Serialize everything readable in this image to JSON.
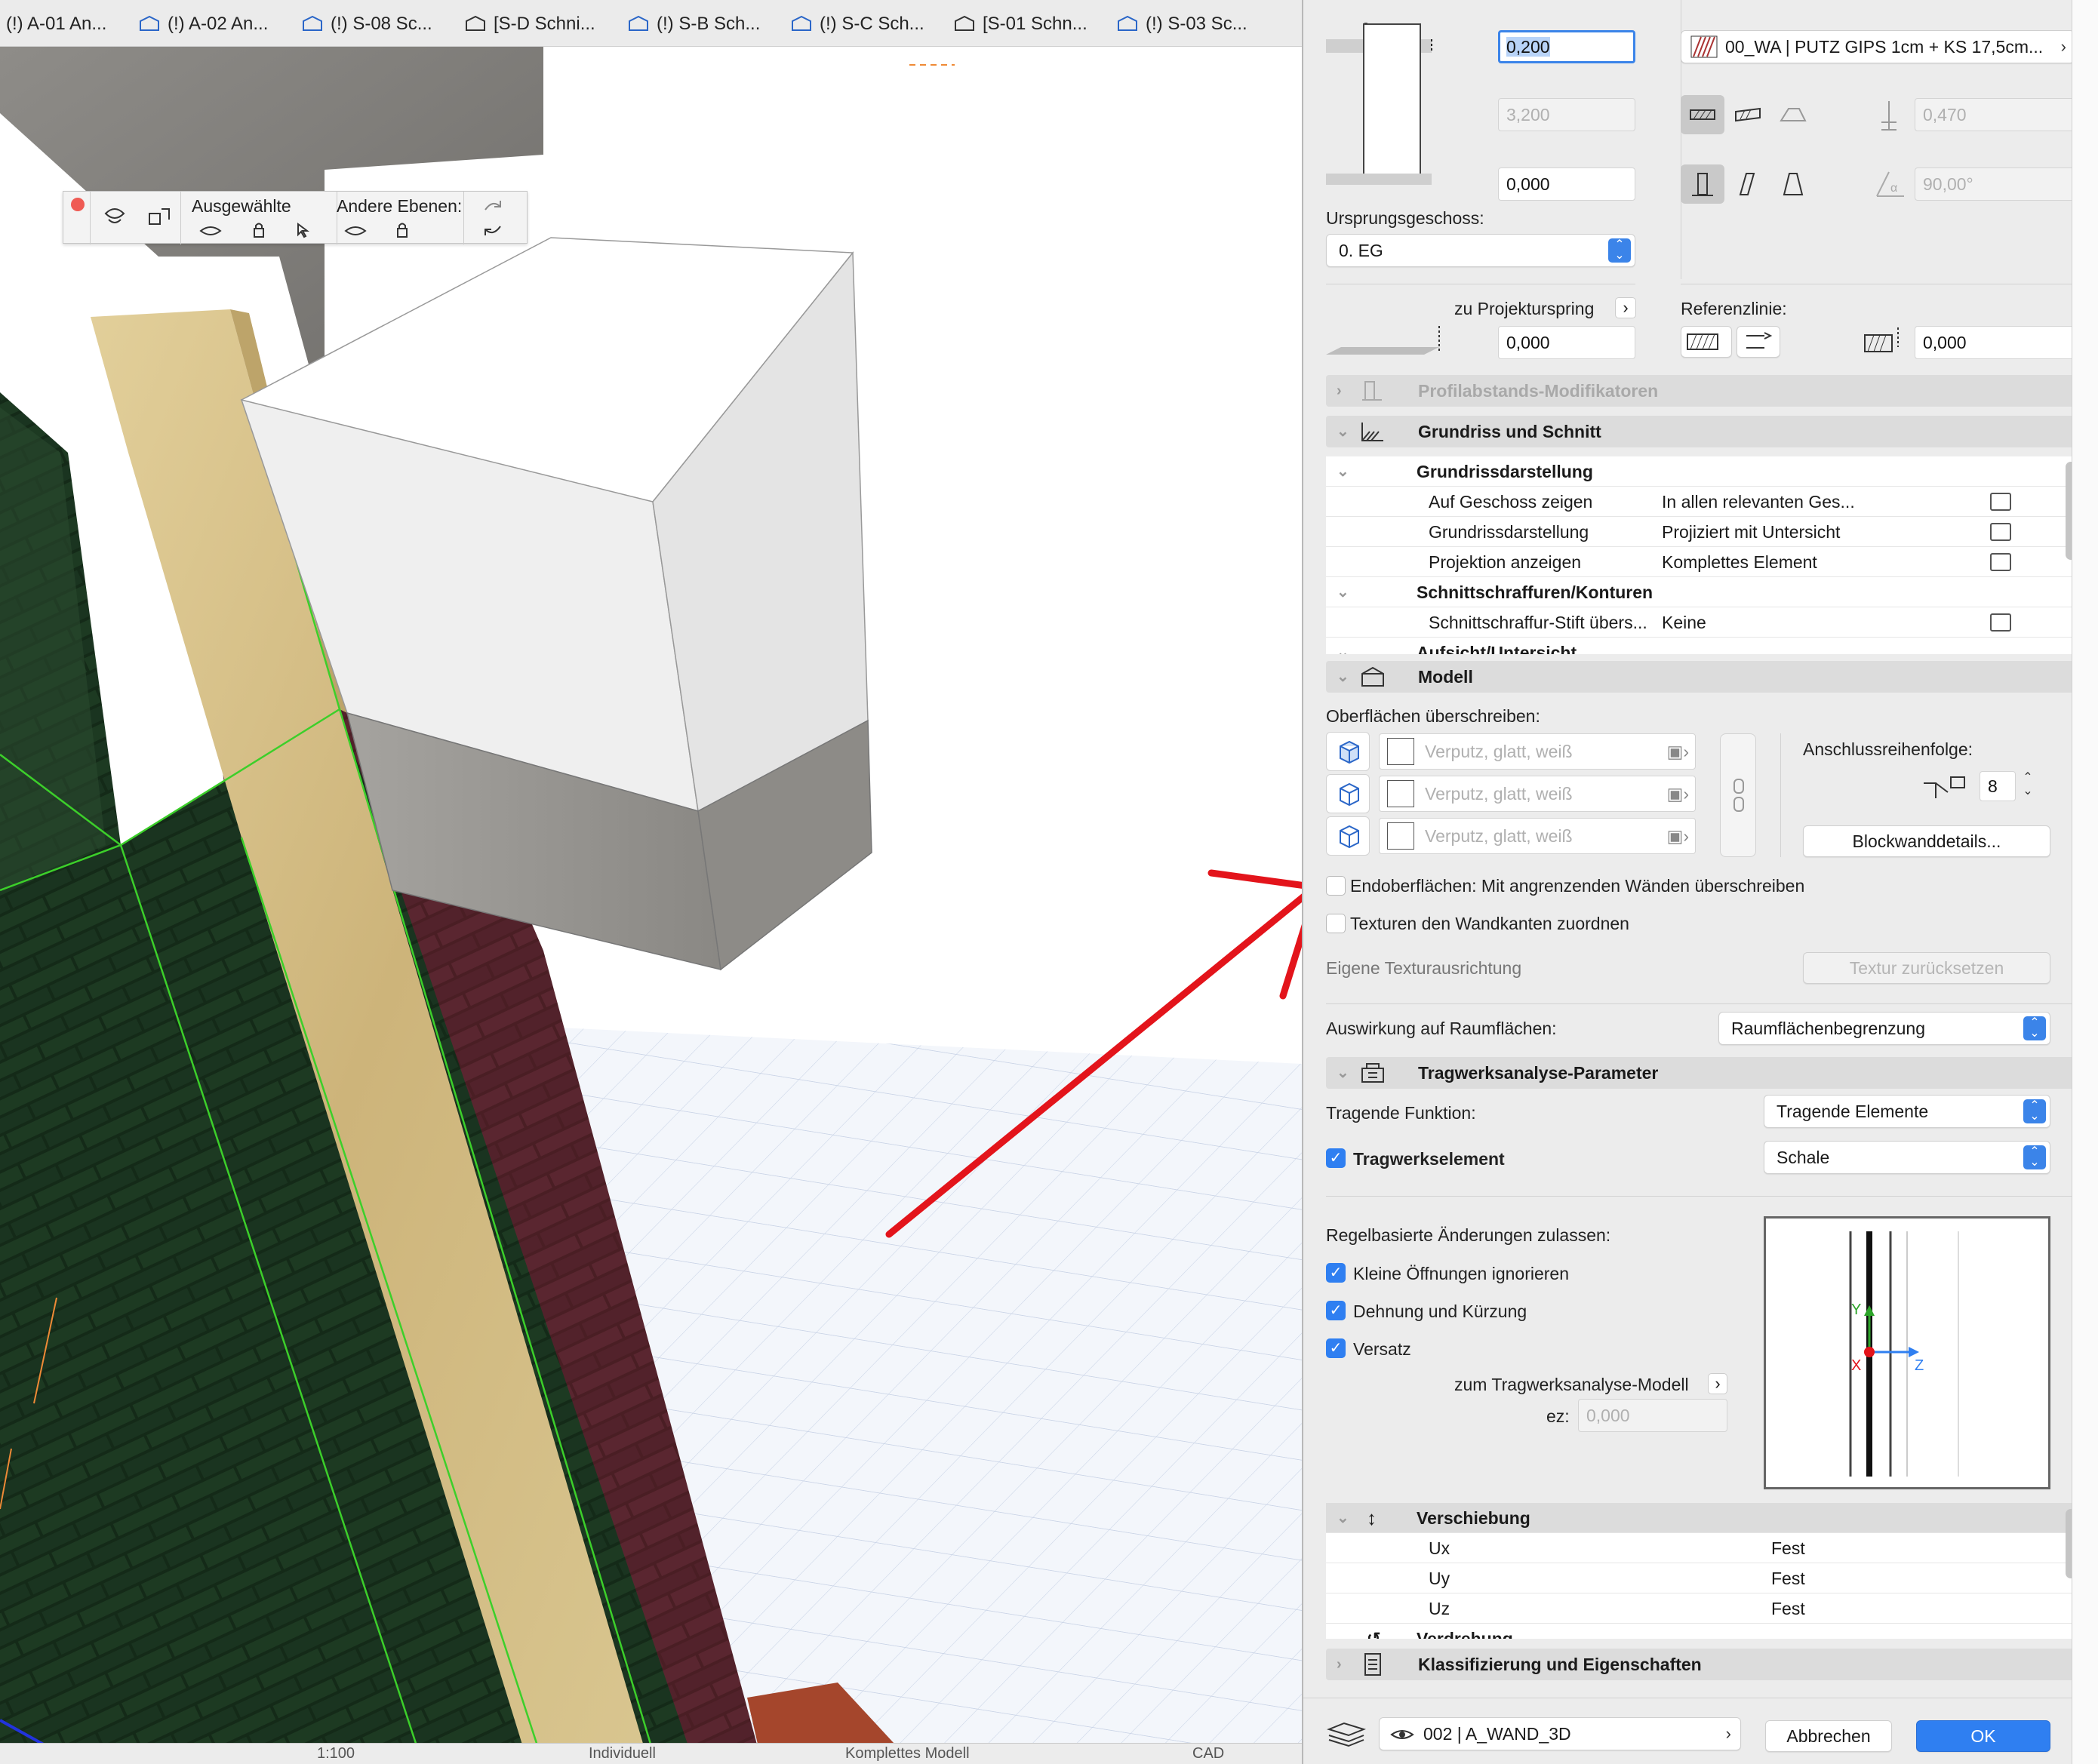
{
  "viewport": {
    "tabs": [
      "(!) A-01 An...",
      "(!) A-02 An...",
      "(!) S-08 Sc...",
      "[S-D Schni...",
      "(!) S-B Sch...",
      "(!) S-C Sch...",
      "[S-01 Schn...",
      "(!) S-03 Sc..."
    ],
    "top_field_a": "0,000",
    "top_field_b": "0. EG",
    "layer_toolbar": {
      "selected_label": "Ausgewählte",
      "other_label": "Andere Ebenen:"
    },
    "bottom_bar": {
      "scale": "1:100",
      "layer_state": "Individuell",
      "model_view": "Komplettes Modell",
      "extra": "CAD"
    }
  },
  "panel": {
    "height_top": "0,200",
    "height_mid": "3,200",
    "height_bottom": "0,000",
    "composite": "00_WA | PUTZ GIPS 1cm + KS 17,5cm...",
    "thickness": "0,470",
    "angle": "90,00°",
    "origin_story_label": "Ursprungsgeschoss:",
    "origin_story_value": "0. EG",
    "project_origin_label": "zu Projekturspring",
    "project_origin_value": "0,000",
    "ref_line_label": "Referenzlinie:",
    "ref_line_offset": "0,000",
    "sections": {
      "profile_mods": "Profilabstands-Modifikatoren",
      "floorplan": "Grundriss und Schnitt",
      "model": "Modell",
      "structural": "Tragwerksanalyse-Parameter",
      "classification": "Klassifizierung und Eigenschaften"
    },
    "floorplan_rows": [
      {
        "label": "Grundrissdarstellung",
        "value": "",
        "group": true
      },
      {
        "label": "Auf Geschoss zeigen",
        "value": "In allen relevanten Ges...",
        "group": false
      },
      {
        "label": "Grundrissdarstellung",
        "value": "Projiziert mit Untersicht",
        "group": false
      },
      {
        "label": "Projektion anzeigen",
        "value": "Komplettes Element",
        "group": false
      },
      {
        "label": "Schnittschraffuren/Konturen",
        "value": "",
        "group": true
      },
      {
        "label": "Schnittschraffur-Stift übers...",
        "value": "Keine",
        "group": false
      },
      {
        "label": "Aufsicht/Untersicht",
        "value": "",
        "group": true
      }
    ],
    "model": {
      "surfaces_label": "Oberflächen überschreiben:",
      "surfaces": [
        "Verputz, glatt, weiß",
        "Verputz, glatt, weiß",
        "Verputz, glatt, weiß"
      ],
      "connection_label": "Anschlussreihenfolge:",
      "connection_value": "8",
      "block_details": "Blockwanddetails...",
      "end_surfaces": "Endoberflächen: Mit angrenzenden Wänden überschreiben",
      "textures_edges": "Texturen den Wandkanten zuordnen",
      "texture_alignment": "Eigene Texturausrichtung",
      "texture_reset": "Textur zurücksetzen",
      "zone_effect_label": "Auswirkung auf Raumflächen:",
      "zone_effect_value": "Raumflächenbegrenzung"
    },
    "structural": {
      "function_label": "Tragende Funktion:",
      "function_value": "Tragende Elemente",
      "element_label": "Tragwerkselement",
      "element_value": "Schale",
      "rules_label": "Regelbasierte Änderungen zulassen:",
      "rules": [
        "Kleine Öffnungen ignorieren",
        "Dehnung und Kürzung",
        "Versatz"
      ],
      "to_model": "zum Tragwerksanalyse-Modell",
      "ez_label": "ez:",
      "ez_value": "0,000",
      "axis_y": "Y",
      "axis_x": "X",
      "axis_z": "Z",
      "displacement_title": "Verschiebung",
      "displacement": [
        {
          "axis": "Ux",
          "value": "Fest"
        },
        {
          "axis": "Uy",
          "value": "Fest"
        },
        {
          "axis": "Uz",
          "value": "Fest"
        }
      ],
      "rotation_title": "Verdrehung"
    },
    "footer": {
      "layer": "002 | A_WAND_3D",
      "cancel": "Abbrechen",
      "ok": "OK"
    }
  },
  "colors": {
    "accent": "#2f7ff1",
    "annotation_arrow": "#e3141b",
    "selection_green": "#3ccf2a"
  }
}
